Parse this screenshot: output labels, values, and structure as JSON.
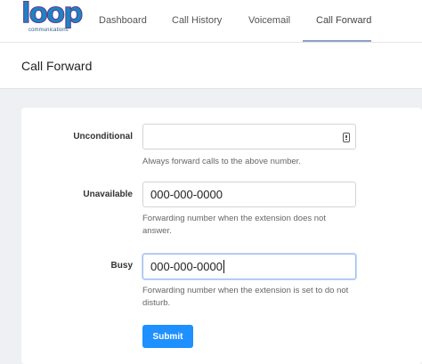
{
  "brand": {
    "logo_text": "loop",
    "logo_sub": "communications"
  },
  "nav": {
    "items": [
      {
        "label": "Dashboard"
      },
      {
        "label": "Call History"
      },
      {
        "label": "Voicemail"
      },
      {
        "label": "Call Forward",
        "active": true
      }
    ]
  },
  "page": {
    "title": "Call Forward"
  },
  "form": {
    "unconditional": {
      "label": "Unconditional",
      "value": "",
      "help": "Always forward calls to the above number."
    },
    "unavailable": {
      "label": "Unavailable",
      "value": "000-000-0000",
      "help": "Forwarding number when the extension does not answer."
    },
    "busy": {
      "label": "Busy",
      "value": "000-000-0000",
      "help": "Forwarding number when the extension is set to do not disturb."
    },
    "submit_label": "Submit"
  },
  "colors": {
    "accent": "#1e90ff",
    "brand_blue": "#1f82c4",
    "brand_purple": "#5a3c8a"
  }
}
